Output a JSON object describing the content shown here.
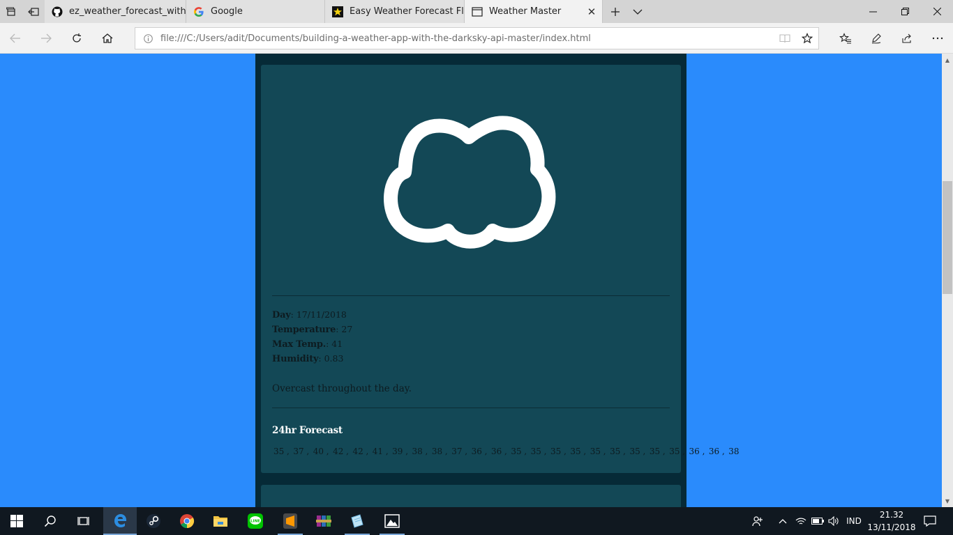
{
  "browser": {
    "tabs": [
      {
        "title": "ez_weather_forecast_with_fl",
        "favicon": "github-icon"
      },
      {
        "title": "Google",
        "favicon": "google-icon"
      },
      {
        "title": "Easy Weather Forecast Flask",
        "favicon": "star-icon"
      },
      {
        "title": "Weather Master",
        "favicon": "page-icon",
        "active": true
      }
    ],
    "url": "file:///C:/Users/adit/Documents/building-a-weather-app-with-the-darksky-api-master/index.html"
  },
  "forecast": {
    "icon": "cloudy-icon",
    "day_label": "Day",
    "day_value": ": 17/11/2018",
    "temp_label": "Temperature",
    "temp_value": ": 27",
    "max_label": "Max Temp.",
    "max_value": ": 41",
    "humidity_label": "Humidity",
    "humidity_value": ": 0.83",
    "summary": "Overcast throughout the day.",
    "hourly_title": "24hr Forecast",
    "hourly": [
      "35",
      "37",
      "40",
      "42",
      "42",
      "41",
      "39",
      "38",
      "38",
      "37",
      "36",
      "36",
      "35",
      "35",
      "35",
      "35",
      "35",
      "35",
      "35",
      "35",
      "35",
      "36",
      "36",
      "38"
    ]
  },
  "taskbar": {
    "language": "IND",
    "time": "21.32",
    "date": "13/11/2018"
  },
  "colors": {
    "page_background": "#2a8bfc",
    "column": "#062a37",
    "card": "#134856"
  }
}
